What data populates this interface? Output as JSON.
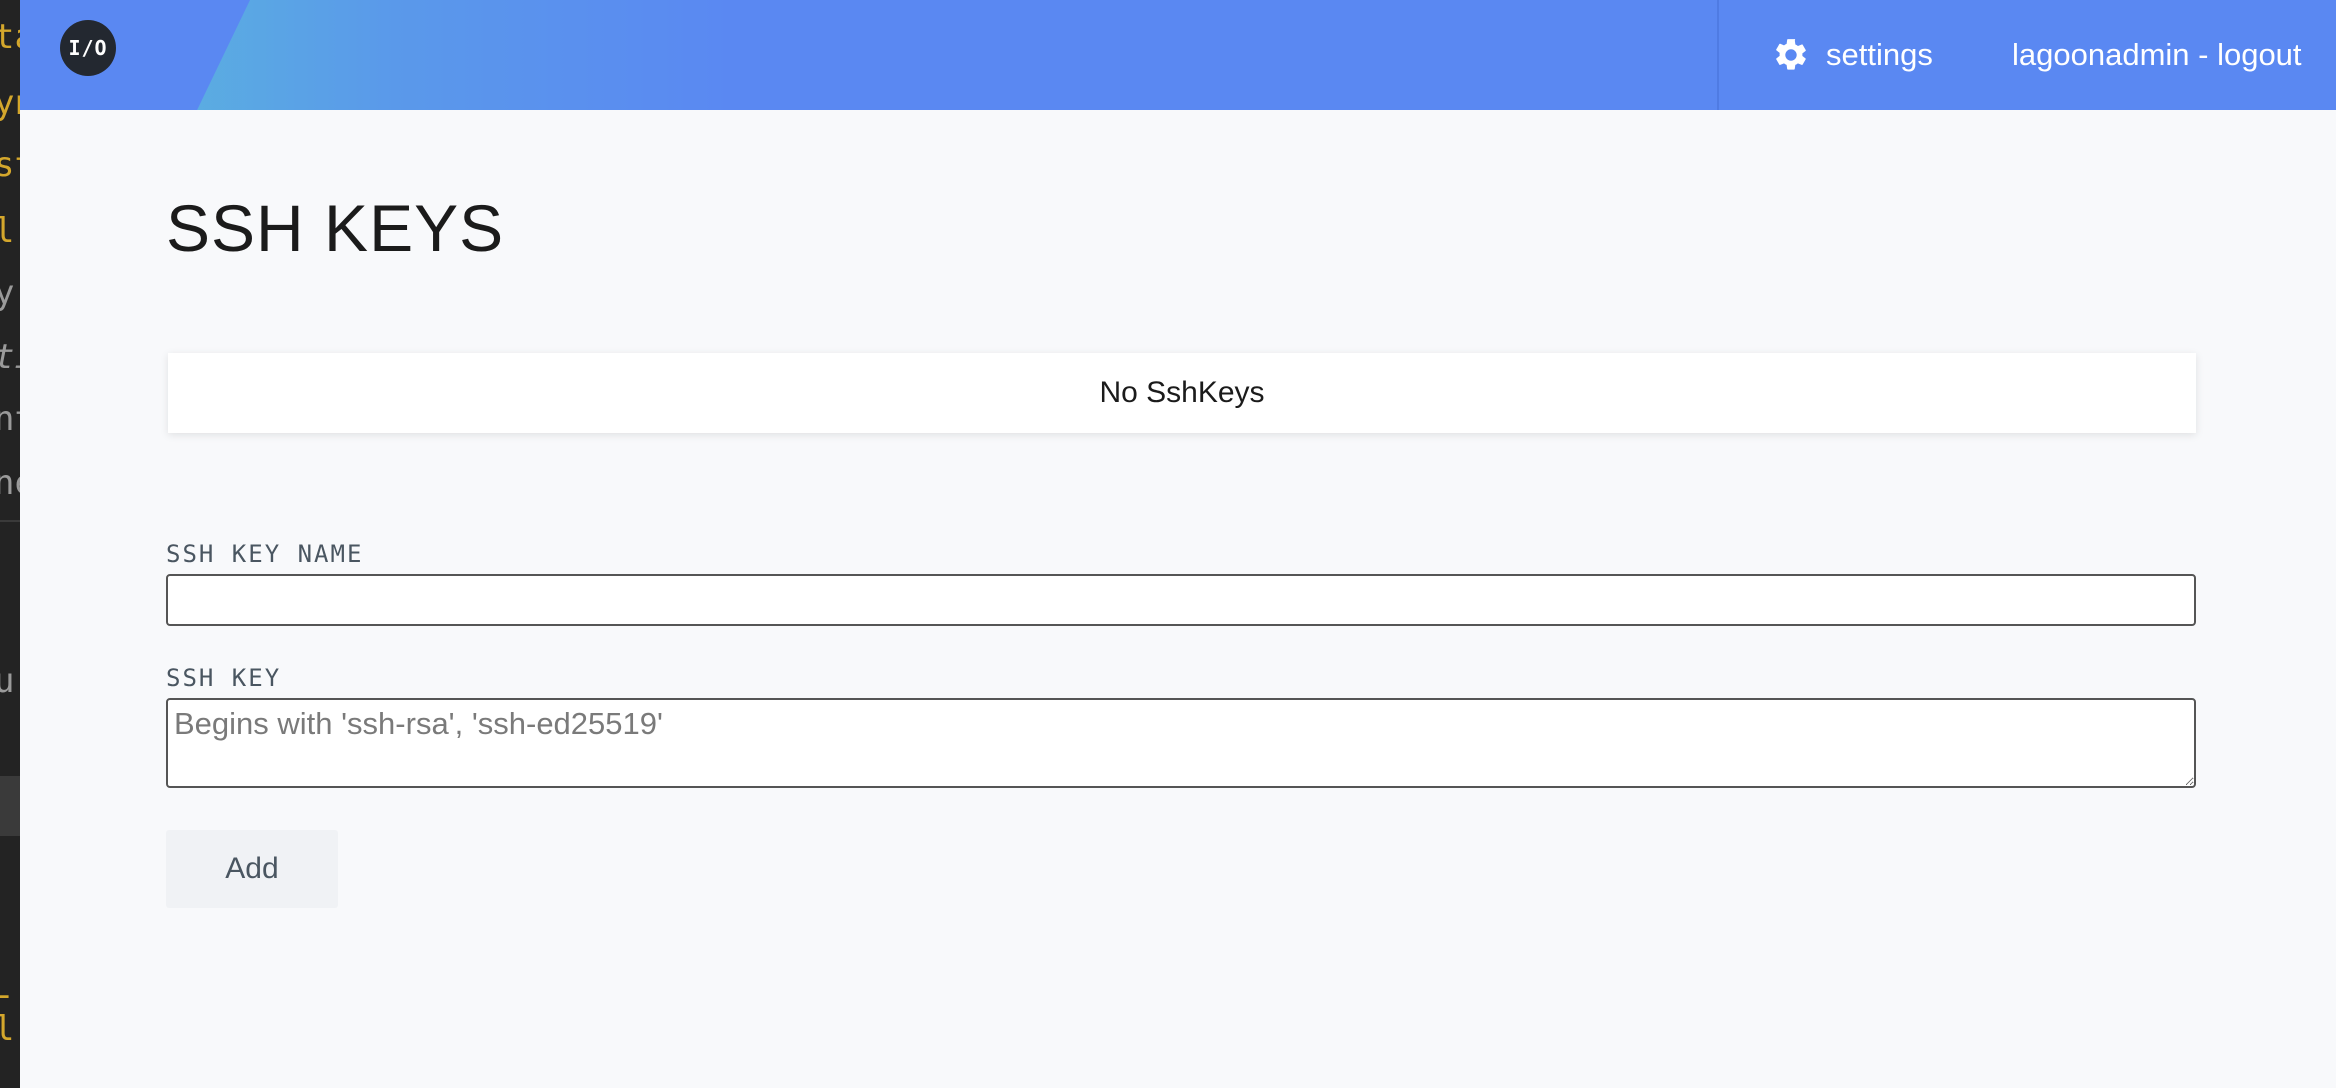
{
  "header": {
    "logo_text": "I/O",
    "settings_label": "settings",
    "user_logout_label": "lagoonadmin - logout"
  },
  "main": {
    "page_title": "SSH KEYS",
    "empty_message": "No SshKeys",
    "form": {
      "name_label": "SSH KEY NAME",
      "name_value": "",
      "key_label": "SSH KEY",
      "key_placeholder": "Begins with 'ssh-rsa', 'ssh-ed25519'",
      "add_button_label": "Add"
    }
  },
  "icons": {
    "settings": "gear-icon",
    "logo": "lagoon-io-logo"
  },
  "colors": {
    "header_blue": "#5a88f2",
    "header_gradient_start": "#5bb4de",
    "page_background": "#f8f9fb",
    "logo_background": "#232830"
  }
}
